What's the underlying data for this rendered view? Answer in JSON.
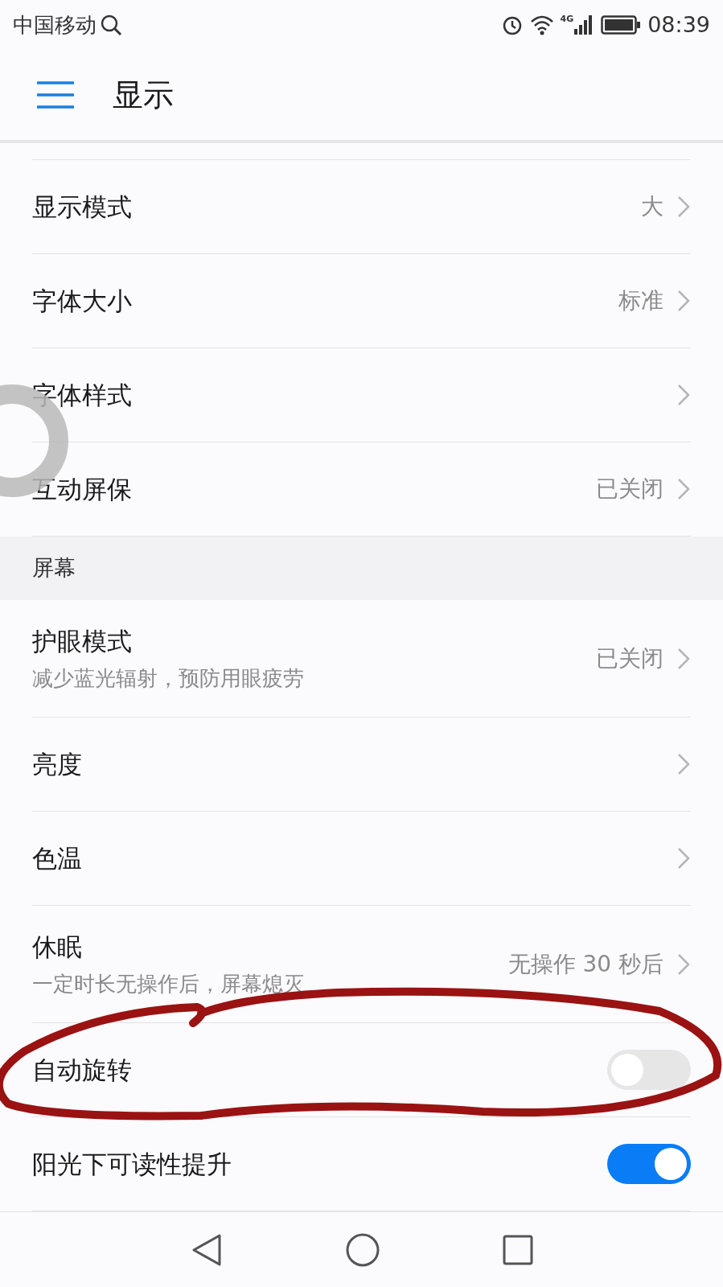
{
  "status_bar": {
    "carrier": "中国移动",
    "network": "4G",
    "time": "08:39"
  },
  "header": {
    "title": "显示"
  },
  "sections": [
    {
      "items": [
        {
          "kind": "link",
          "title": "显示模式",
          "value": "大"
        },
        {
          "kind": "link",
          "title": "字体大小",
          "value": "标准"
        },
        {
          "kind": "link",
          "title": "字体样式"
        },
        {
          "kind": "link",
          "title": "互动屏保",
          "value": "已关闭"
        }
      ]
    },
    {
      "header": "屏幕",
      "items": [
        {
          "kind": "link",
          "title": "护眼模式",
          "subtitle": "减少蓝光辐射，预防用眼疲劳",
          "value": "已关闭"
        },
        {
          "kind": "link",
          "title": "亮度"
        },
        {
          "kind": "link",
          "title": "色温"
        },
        {
          "kind": "link",
          "title": "休眠",
          "subtitle": "一定时长无操作后，屏幕熄灭",
          "value": "无操作 30 秒后"
        },
        {
          "kind": "toggle",
          "title": "自动旋转",
          "on": false
        },
        {
          "kind": "toggle",
          "title": "阳光下可读性提升",
          "on": true
        }
      ]
    }
  ]
}
